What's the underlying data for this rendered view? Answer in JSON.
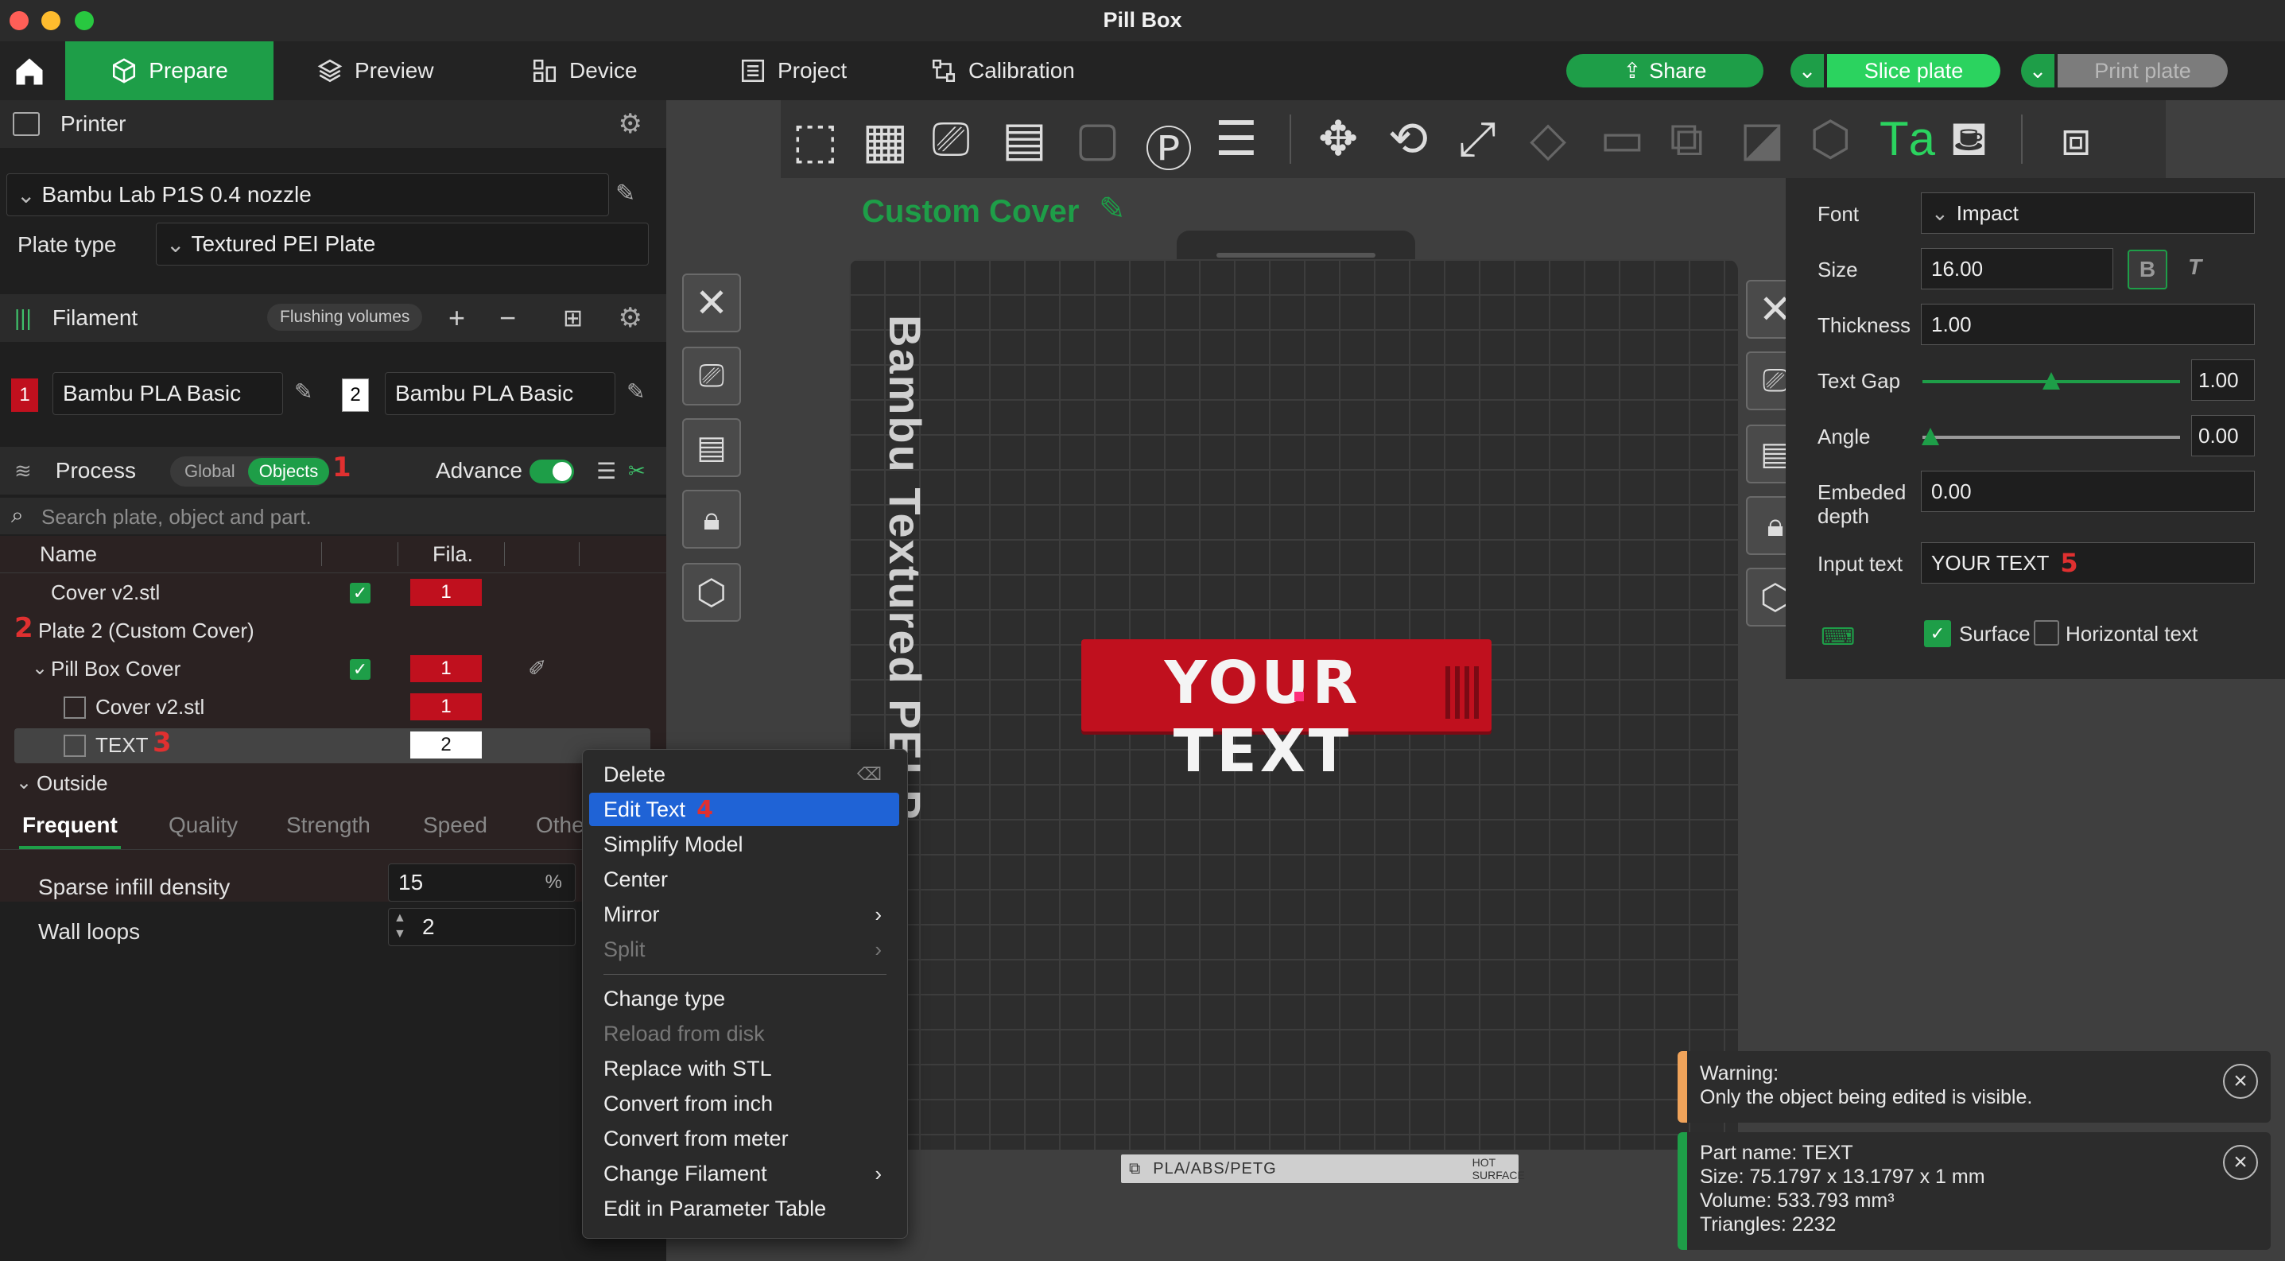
{
  "window": {
    "title": "Pill Box"
  },
  "nav": {
    "tabs": [
      {
        "label": "Prepare"
      },
      {
        "label": "Preview"
      },
      {
        "label": "Device"
      },
      {
        "label": "Project"
      },
      {
        "label": "Calibration"
      }
    ],
    "share": "Share",
    "slice": "Slice plate",
    "print": "Print plate"
  },
  "printer": {
    "header": "Printer",
    "name": "Bambu Lab P1S 0.4 nozzle",
    "plate_type_label": "Plate type",
    "plate_type": "Textured PEI Plate"
  },
  "filament": {
    "header": "Filament",
    "flushing": "Flushing volumes",
    "slots": [
      {
        "num": "1",
        "name": "Bambu PLA Basic",
        "color": "#c0101e"
      },
      {
        "num": "2",
        "name": "Bambu PLA Basic",
        "color": "#ffffff"
      }
    ]
  },
  "process": {
    "header": "Process",
    "global": "Global",
    "objects": "Objects",
    "advance": "Advance",
    "search_placeholder": "Search plate, object and part."
  },
  "tree": {
    "col_name": "Name",
    "col_fila": "Fila.",
    "rows": [
      {
        "name": "Cover v2.stl",
        "fila": "1"
      },
      {
        "name": "Plate 2 (Custom Cover)"
      },
      {
        "name": "Pill Box Cover",
        "fila": "1"
      },
      {
        "name": "Cover v2.stl",
        "fila": "1"
      },
      {
        "name": "TEXT",
        "fila": "2"
      },
      {
        "name": "Outside"
      }
    ]
  },
  "settings_tabs": [
    "Frequent",
    "Quality",
    "Strength",
    "Speed",
    "Othe"
  ],
  "settings": {
    "sparse_label": "Sparse infill density",
    "sparse_value": "15",
    "sparse_unit": "%",
    "wall_label": "Wall loops",
    "wall_value": "2"
  },
  "annotations": [
    "1",
    "2",
    "3",
    "4",
    "5"
  ],
  "viewport": {
    "plate_name": "Custom Cover",
    "plate_side_text": "Bambu Textured PEI P",
    "model_text": "YOUR TEXT",
    "plate_footer": "PLA/ABS/PETG",
    "plate_footer_hot": "HOT SURFACE"
  },
  "text_panel": {
    "font_label": "Font",
    "font_value": "Impact",
    "size_label": "Size",
    "size_value": "16.00",
    "bold": "B",
    "italic": "T",
    "thickness_label": "Thickness",
    "thickness_value": "1.00",
    "gap_label": "Text Gap",
    "gap_value": "1.00",
    "gap_fraction": 0.5,
    "angle_label": "Angle",
    "angle_value": "0.00",
    "angle_fraction": 0.0,
    "embed_label_1": "Embeded",
    "embed_label_2": "depth",
    "embed_value": "0.00",
    "input_label": "Input text",
    "input_value": "YOUR TEXT",
    "surface": "Surface",
    "horizontal": "Horizontal text"
  },
  "context_menu": {
    "items": [
      {
        "label": "Delete"
      },
      {
        "label": "Edit Text"
      },
      {
        "label": "Simplify Model"
      },
      {
        "label": "Center"
      },
      {
        "label": "Mirror"
      },
      {
        "label": "Split"
      },
      {
        "label": "Change type"
      },
      {
        "label": "Reload from disk"
      },
      {
        "label": "Replace with STL"
      },
      {
        "label": "Convert from inch"
      },
      {
        "label": "Convert from meter"
      },
      {
        "label": "Change Filament"
      },
      {
        "label": "Edit in Parameter Table"
      }
    ]
  },
  "notifications": {
    "warning_title": "Warning:",
    "warning_body": "Only the object being edited is visible.",
    "part_name": "Part name: TEXT",
    "part_size": "Size: 75.1797 x 13.1797 x 1 mm",
    "part_volume": "Volume: 533.793 mm³",
    "part_triangles": "Triangles: 2232"
  },
  "colors": {
    "accent": "#1e9e48",
    "filament1": "#c0101e",
    "warning": "#f0a35a",
    "highlight": "#1f63d6"
  }
}
